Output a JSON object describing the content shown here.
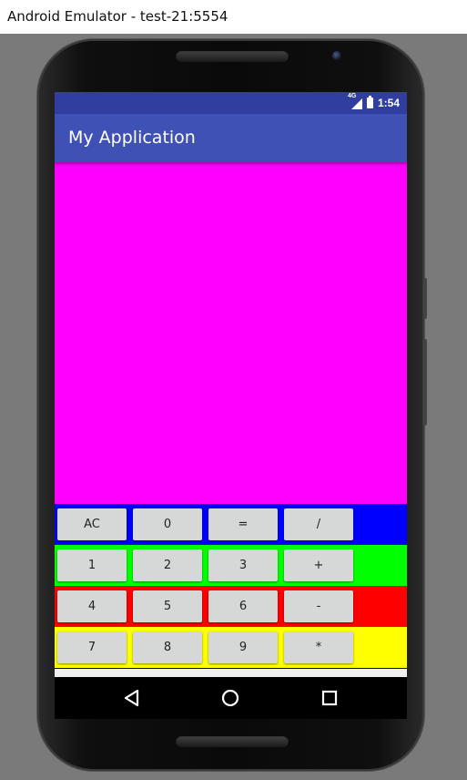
{
  "window": {
    "title": "Android Emulator - test-21:5554"
  },
  "status_bar": {
    "network": "4G",
    "time": "1:54",
    "color": "#303f9f"
  },
  "app_bar": {
    "title": "My Application",
    "color": "#3f51b5"
  },
  "display": {
    "color": "#ff00ff"
  },
  "keypad": {
    "rows": [
      {
        "color": "#0000ff",
        "keys": [
          "AC",
          "0",
          "=",
          "/"
        ]
      },
      {
        "color": "#00ff00",
        "keys": [
          "1",
          "2",
          "3",
          "+"
        ]
      },
      {
        "color": "#ff0000",
        "keys": [
          "4",
          "5",
          "6",
          "-"
        ]
      },
      {
        "color": "#ffff00",
        "keys": [
          "7",
          "8",
          "9",
          "*"
        ]
      }
    ]
  },
  "nav_bar": {
    "icons": [
      "back-icon",
      "home-icon",
      "recents-icon"
    ]
  }
}
